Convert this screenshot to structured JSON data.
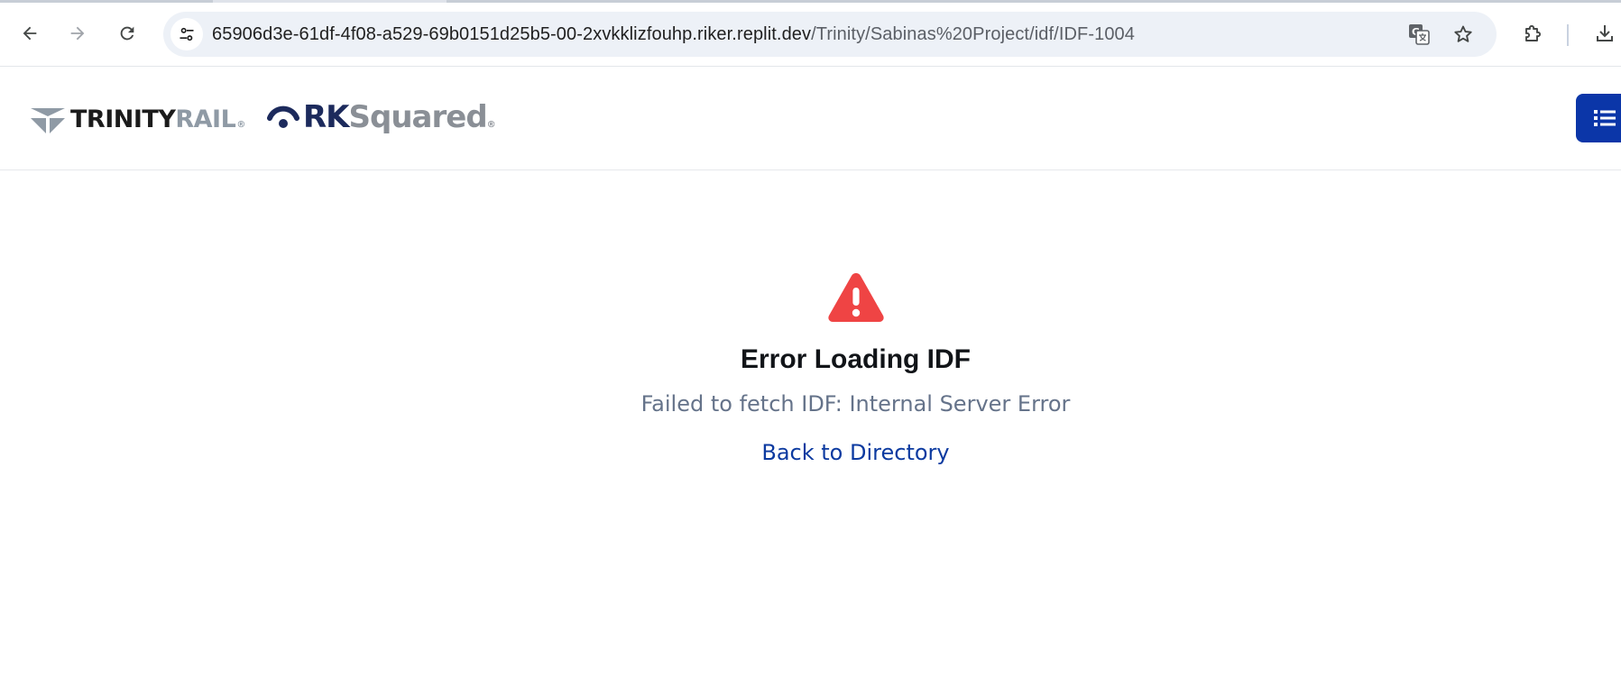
{
  "browser": {
    "url_host": "65906d3e-61df-4f08-a529-69b0151d25b5-00-2xvkklizfouhp.riker.replit.dev",
    "url_path": "/Trinity/Sabinas%20Project/idf/IDF-1004",
    "icons": {
      "back": "arrow-left-icon",
      "forward": "arrow-right-icon",
      "reload": "reload-icon",
      "site_info": "tune-icon",
      "translate": "translate-icon",
      "bookmark": "star-icon",
      "extensions": "puzzle-icon",
      "download": "download-icon"
    }
  },
  "header": {
    "logo_trinity_a": "TRINITY",
    "logo_trinity_b": "RAIL",
    "logo_trinity_reg": "®",
    "logo_rk_a": "RK",
    "logo_rk_b": "Squared",
    "logo_rk_reg": "®",
    "menu_icon": "list-icon"
  },
  "error": {
    "icon": "warning-triangle-icon",
    "title": "Error Loading IDF",
    "message": "Failed to fetch IDF: Internal Server Error",
    "back_link": "Back to Directory"
  },
  "colors": {
    "accent": "#0b36a8",
    "error_red": "#ef4444",
    "text_dark": "#111418",
    "text_muted": "#65738a",
    "link": "#0c3aa0",
    "omnibox_bg": "#edf1f7",
    "trinity_gray": "#8f9aa5",
    "rk_navy": "#1c2a5c"
  }
}
